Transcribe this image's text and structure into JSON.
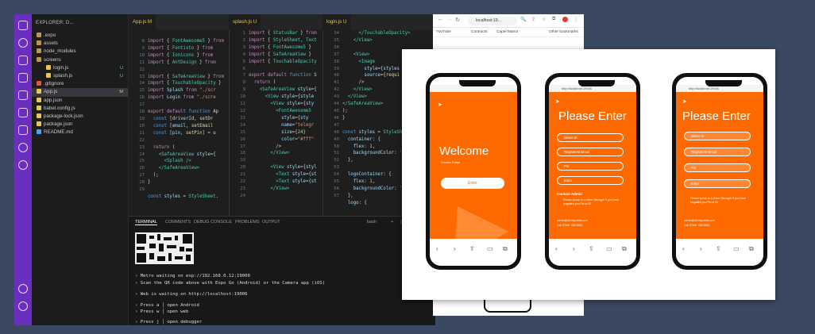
{
  "vscode": {
    "explorer_header": "EXPLORER: D...",
    "files": [
      {
        "name": ".expo",
        "badge": "",
        "color": "#c09553",
        "folder": true
      },
      {
        "name": "assets",
        "badge": "",
        "color": "#c09553",
        "folder": true
      },
      {
        "name": "node_modules",
        "badge": "",
        "color": "#c09553",
        "folder": true
      },
      {
        "name": "screens",
        "badge": "",
        "color": "#c09553",
        "folder": true
      },
      {
        "name": "login.js",
        "badge": "U",
        "color": "#e6c84a",
        "folder": false
      },
      {
        "name": "splash.js",
        "badge": "U",
        "color": "#e6c84a",
        "folder": false
      },
      {
        "name": ".gitignore",
        "badge": "",
        "color": "#e2583e",
        "folder": false
      },
      {
        "name": "App.js",
        "badge": "M",
        "color": "#e6c84a",
        "folder": false
      },
      {
        "name": "app.json",
        "badge": "",
        "color": "#e6c84a",
        "folder": false
      },
      {
        "name": "babel.config.js",
        "badge": "",
        "color": "#e6c84a",
        "folder": false
      },
      {
        "name": "package-lock.json",
        "badge": "",
        "color": "#e6c84a",
        "folder": false
      },
      {
        "name": "package.json",
        "badge": "",
        "color": "#e6c84a",
        "folder": false
      },
      {
        "name": "README.md",
        "badge": "",
        "color": "#42a5f5",
        "folder": false
      }
    ],
    "tabs": {
      "app": "App.js  M",
      "splash": "splash.js  U",
      "login": "login.js  U"
    },
    "terminal_tabs": [
      "TERMINAL",
      "COMMENTS",
      "DEBUG CONSOLE",
      "PROBLEMS",
      "OUTPUT"
    ],
    "terminal_shell": "bash",
    "terminal_lines": [
      "› Metro waiting on exp://192.168.0.12:19000",
      "› Scan the QR code above with Expo Go (Android) or the Camera app (iOS)",
      "› Web is waiting on http://localhost:19006",
      "› Press a │ open Android",
      "› Press w │ open web",
      "› Press j │ open debugger"
    ]
  },
  "chrome": {
    "url": "localhost:19...",
    "bookmarks": [
      "YouTube",
      "Contracts",
      "Capel Manor",
      "Other bookmarks"
    ]
  },
  "phones": {
    "addr": "http://localhost:19006",
    "welcome": "Welcome",
    "welcome_sub": "Drivers Portal",
    "enter_btn": "Enter",
    "please_enter": "Please Enter",
    "fields": [
      "Driver ID",
      "Registered Email",
      "Pin",
      "Enter"
    ],
    "contact": "Contact Admin",
    "contact_note": "Please speak to a driver Manager if you have forgotten you Pin or ID",
    "email": "admin@drivesportal.com",
    "call": "Call 07047 258 9633"
  }
}
